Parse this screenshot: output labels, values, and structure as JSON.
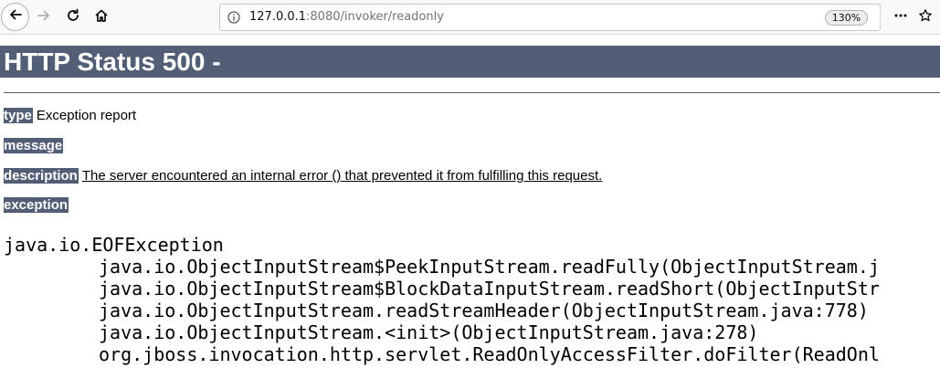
{
  "browser": {
    "url_host": "127.0.0.1",
    "url_rest": ":8080/invoker/readonly",
    "zoom": "130%"
  },
  "page": {
    "heading": "HTTP Status 500 -",
    "type_label": "type",
    "type_value": "Exception report",
    "message_label": "message",
    "message_value": "",
    "description_label": "description",
    "description_value": "The server encountered an internal error () that prevented it from fulfilling this request.",
    "exception_label": "exception",
    "stack": [
      "java.io.EOFException",
      "java.io.ObjectInputStream$PeekInputStream.readFully(ObjectInputStream.j",
      "java.io.ObjectInputStream$BlockDataInputStream.readShort(ObjectInputStr",
      "java.io.ObjectInputStream.readStreamHeader(ObjectInputStream.java:778)",
      "java.io.ObjectInputStream.<init>(ObjectInputStream.java:278)",
      "org.jboss.invocation.http.servlet.ReadOnlyAccessFilter.doFilter(ReadOnl"
    ]
  },
  "colors": {
    "heading_bg": "#525d76",
    "heading_text": "#ffffff"
  }
}
